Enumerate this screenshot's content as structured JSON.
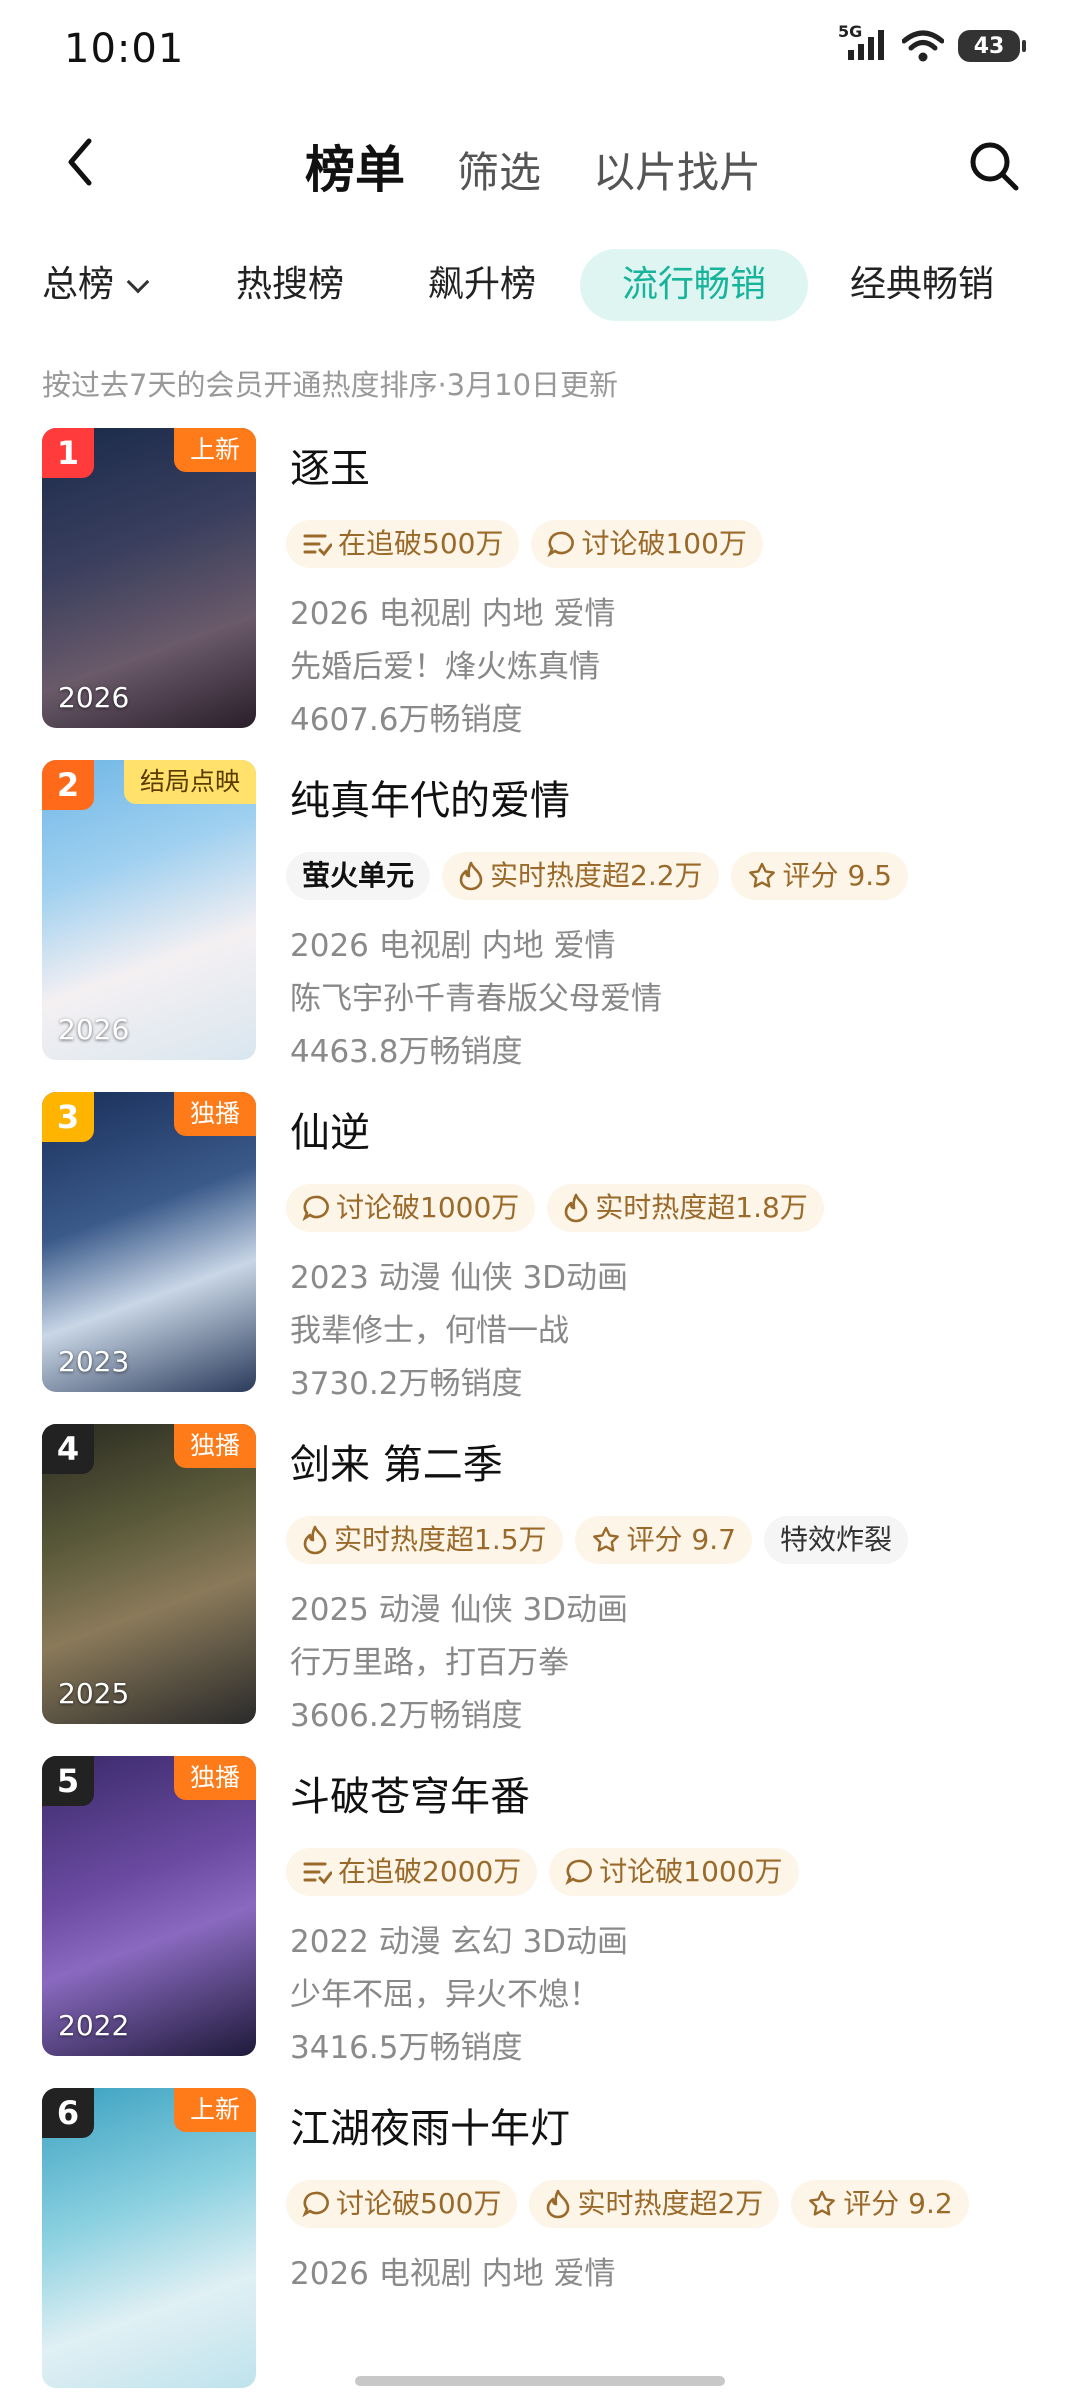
{
  "status": {
    "time": "10:01",
    "network": "5G",
    "battery": "43"
  },
  "nav": {
    "tabs": [
      "榜单",
      "筛选",
      "以片找片"
    ]
  },
  "categories": {
    "dropdown": "总榜",
    "tabs": [
      "热搜榜",
      "飙升榜",
      "流行畅销",
      "经典畅销"
    ],
    "active": "流行畅销"
  },
  "note": "按过去7天的会员开通热度排序·3月10日更新",
  "items": [
    {
      "rank": "1",
      "tag": "上新",
      "year": "2026",
      "title": "逐玉",
      "badges": [
        {
          "icon": "follow-icon",
          "text": "在追破500万"
        },
        {
          "icon": "comment-icon",
          "text": "讨论破100万"
        }
      ],
      "meta": "2026 电视剧 内地 爱情",
      "desc": "先婚后爱！烽火炼真情",
      "sales": "4607.6万畅销度"
    },
    {
      "rank": "2",
      "tag": "结局点映",
      "year": "2026",
      "title": "纯真年代的爱情",
      "badges": [
        {
          "icon": "brand-icon",
          "text": "萤火单元"
        },
        {
          "icon": "flame-icon",
          "text": "实时热度超2.2万"
        },
        {
          "icon": "star-icon",
          "text": "评分 9.5"
        }
      ],
      "meta": "2026 电视剧 内地 爱情",
      "desc": "陈飞宇孙千青春版父母爱情",
      "sales": "4463.8万畅销度"
    },
    {
      "rank": "3",
      "tag": "独播",
      "year": "2023",
      "title": "仙逆",
      "badges": [
        {
          "icon": "comment-icon",
          "text": "讨论破1000万"
        },
        {
          "icon": "flame-icon",
          "text": "实时热度超1.8万"
        }
      ],
      "meta": "2023 动漫 仙侠 3D动画",
      "desc": "我辈修士，何惜一战",
      "sales": "3730.2万畅销度"
    },
    {
      "rank": "4",
      "tag": "独播",
      "year": "2025",
      "title": "剑来 第二季",
      "badges": [
        {
          "icon": "flame-icon",
          "text": "实时热度超1.5万"
        },
        {
          "icon": "star-icon",
          "text": "评分 9.7"
        },
        {
          "icon": "none",
          "text": "特效炸裂"
        }
      ],
      "meta": "2025 动漫 仙侠 3D动画",
      "desc": "行万里路，打百万拳",
      "sales": "3606.2万畅销度"
    },
    {
      "rank": "5",
      "tag": "独播",
      "year": "2022",
      "title": "斗破苍穹年番",
      "badges": [
        {
          "icon": "follow-icon",
          "text": "在追破2000万"
        },
        {
          "icon": "comment-icon",
          "text": "讨论破1000万"
        }
      ],
      "meta": "2022 动漫 玄幻 3D动画",
      "desc": "少年不屈，异火不熄！",
      "sales": "3416.5万畅销度"
    },
    {
      "rank": "6",
      "tag": "上新",
      "year": "",
      "title": "江湖夜雨十年灯",
      "badges": [
        {
          "icon": "comment-icon",
          "text": "讨论破500万"
        },
        {
          "icon": "flame-icon",
          "text": "实时热度超2万"
        },
        {
          "icon": "star-icon",
          "text": "评分 9.2"
        }
      ],
      "meta": "2026 电视剧 内地 爱情",
      "desc": "",
      "sales": ""
    }
  ],
  "colors": {
    "accent": "#17b39b",
    "rank1": "#ff3b3b",
    "rank2": "#ff6a1a",
    "rank3": "#ffb400",
    "rankN": "#222222",
    "badge_bg": "#fdf5e8",
    "badge_text": "#9a6a2b"
  }
}
